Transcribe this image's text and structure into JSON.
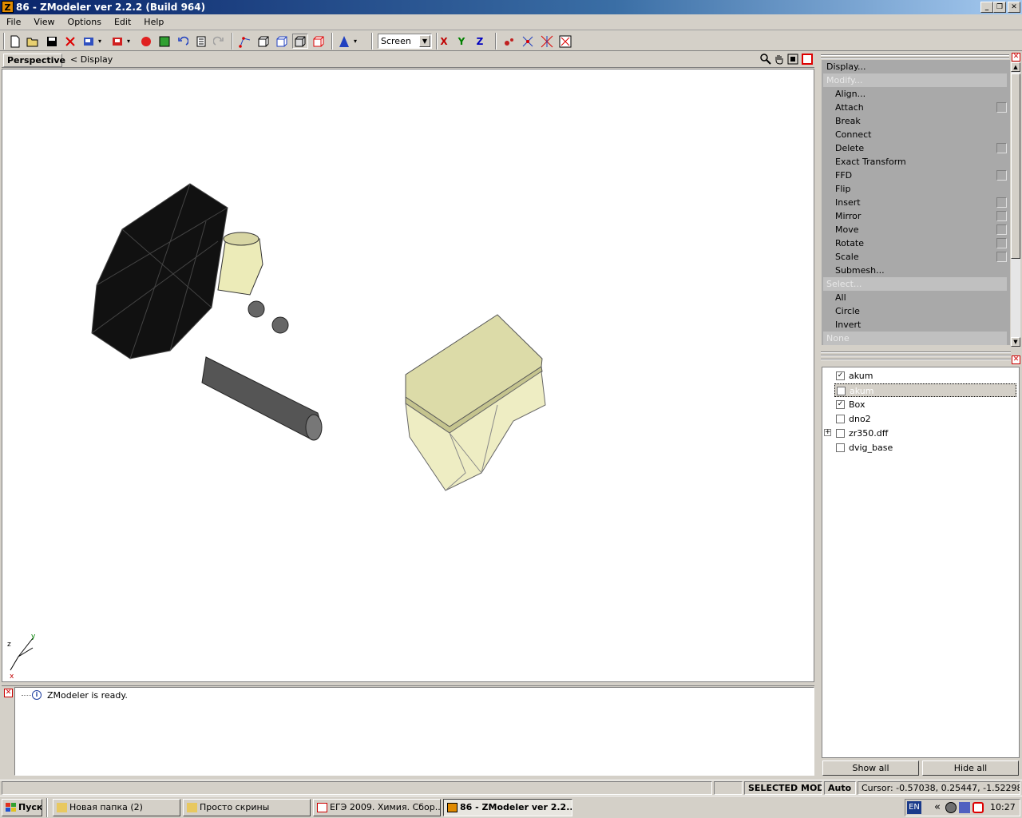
{
  "window": {
    "title": "86 - ZModeler ver 2.2.2 (Build 964)",
    "app_icon_letter": "Z",
    "minimize": "_",
    "restore": "❐",
    "close": "✕"
  },
  "menu": [
    "File",
    "View",
    "Options",
    "Edit",
    "Help"
  ],
  "toolbar": {
    "view_mode": "Screen",
    "axis_x": "X",
    "axis_y": "Y",
    "axis_z": "Z",
    "axis_x_color": "#c00000",
    "axis_y_color": "#008000",
    "axis_z_color": "#0000c0"
  },
  "viewport": {
    "tab": "Perspective",
    "crumb": "<  Display",
    "gizmo": {
      "z": "z",
      "y": "y",
      "x": "x"
    }
  },
  "log": {
    "messages": [
      "ZModeler is ready."
    ]
  },
  "commands": {
    "items": [
      {
        "label": "Display...",
        "kind": "top",
        "checkbox": false
      },
      {
        "label": "Modify...",
        "kind": "head",
        "checkbox": false
      },
      {
        "label": "Align...",
        "kind": "sub",
        "checkbox": false
      },
      {
        "label": "Attach",
        "kind": "sub",
        "checkbox": true
      },
      {
        "label": "Break",
        "kind": "sub",
        "checkbox": false
      },
      {
        "label": "Connect",
        "kind": "sub",
        "checkbox": false
      },
      {
        "label": "Delete",
        "kind": "sub",
        "checkbox": true
      },
      {
        "label": "Exact Transform",
        "kind": "sub",
        "checkbox": false
      },
      {
        "label": "FFD",
        "kind": "sub",
        "checkbox": true
      },
      {
        "label": "Flip",
        "kind": "sub",
        "checkbox": false
      },
      {
        "label": "Insert",
        "kind": "sub",
        "checkbox": true
      },
      {
        "label": "Mirror",
        "kind": "sub",
        "checkbox": true
      },
      {
        "label": "Move",
        "kind": "sub",
        "checkbox": true
      },
      {
        "label": "Rotate",
        "kind": "sub",
        "checkbox": true
      },
      {
        "label": "Scale",
        "kind": "sub",
        "checkbox": true
      },
      {
        "label": "Submesh...",
        "kind": "sub",
        "checkbox": false
      },
      {
        "label": "Select...",
        "kind": "head",
        "checkbox": false
      },
      {
        "label": "All",
        "kind": "sub",
        "checkbox": false
      },
      {
        "label": "Circle",
        "kind": "sub",
        "checkbox": false
      },
      {
        "label": "Invert",
        "kind": "sub",
        "checkbox": false
      },
      {
        "label": "None",
        "kind": "head",
        "checkbox": false
      }
    ]
  },
  "objects": {
    "items": [
      {
        "label": "akum",
        "checked": true,
        "selected": false,
        "expandable": false
      },
      {
        "label": "akum",
        "checked": false,
        "selected": true,
        "expandable": false
      },
      {
        "label": "Box",
        "checked": true,
        "selected": false,
        "expandable": false
      },
      {
        "label": "dno2",
        "checked": false,
        "selected": false,
        "expandable": false
      },
      {
        "label": "zr350.dff",
        "checked": false,
        "selected": false,
        "expandable": true
      },
      {
        "label": "dvig_base",
        "checked": false,
        "selected": false,
        "expandable": false
      }
    ],
    "show_all": "Show all",
    "hide_all": "Hide all"
  },
  "status": {
    "mode": "SELECTED MODE",
    "auto": "Auto",
    "cursor": "Cursor: -0.57038, 0.25447, -1.52298"
  },
  "taskbar": {
    "start": "Пуск",
    "tasks": [
      {
        "label": "Новая папка (2)",
        "icon": "folder-icon",
        "active": false
      },
      {
        "label": "Просто скрины",
        "icon": "folder-icon",
        "active": false
      },
      {
        "label": "ЕГЭ 2009. Химия. Сбор...",
        "icon": "pdf-icon",
        "active": false
      },
      {
        "label": "86 - ZModeler ver 2.2....",
        "icon": "zmodeler-icon",
        "active": true
      }
    ],
    "lang": "EN",
    "expand": "«",
    "clock": "10:27"
  }
}
